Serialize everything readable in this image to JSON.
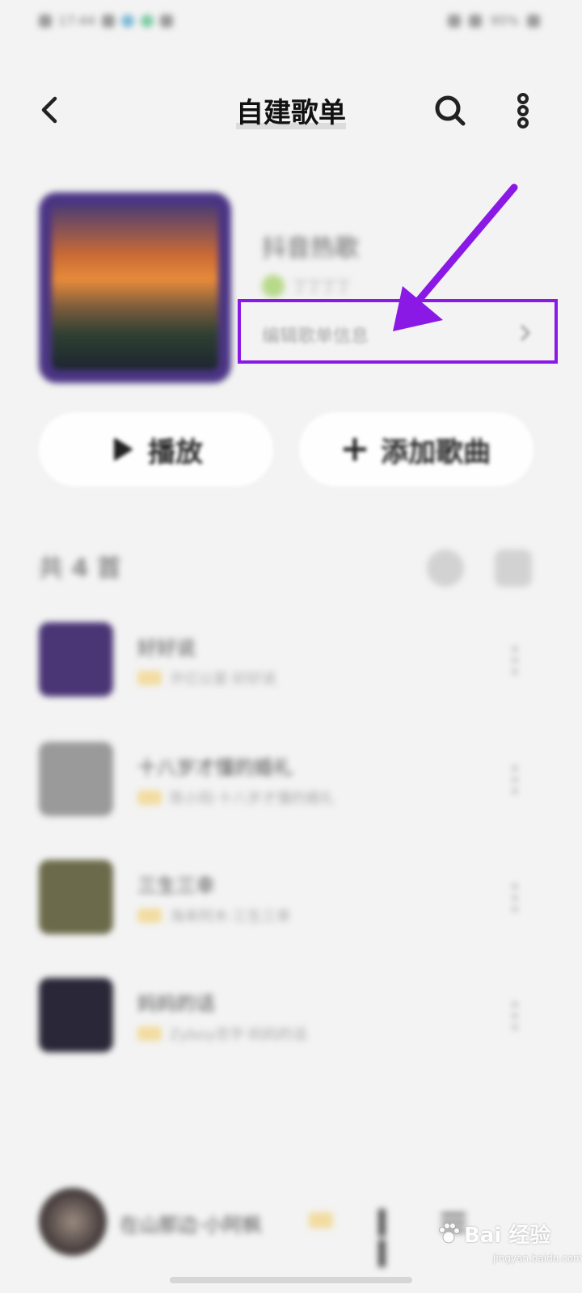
{
  "status_bar": {
    "time": "17:44",
    "battery": "95%"
  },
  "nav": {
    "title": "自建歌单"
  },
  "playlist": {
    "title": "抖音热歌",
    "creator": "丁丁丁丁",
    "edit_info_label": "编辑歌单信息"
  },
  "actions": {
    "play_label": "播放",
    "add_label": "添加歌曲"
  },
  "songs_section": {
    "count_label": "共 4 首",
    "songs": [
      {
        "name": "好好说",
        "artist": "许亿以星·好好说",
        "thumb_color": "#4a3575"
      },
      {
        "name": "十八岁才懂的婚礼",
        "artist": "陈小阳·十八岁才懂的婚礼",
        "thumb_color": "#9a9a9a"
      },
      {
        "name": "三生三幸",
        "artist": "海来阿木·三生三幸",
        "thumb_color": "#6b6a4a"
      },
      {
        "name": "妈妈的话",
        "artist": "Zyboy忠宇·妈妈的话",
        "thumb_color": "#2a2838"
      }
    ]
  },
  "mini_player": {
    "now_playing": "在山那边·小阿枫"
  },
  "watermark": {
    "brand": "Bai 经验",
    "sub": "jingyan.baidu.com"
  },
  "colors": {
    "annotation": "#8b19e6",
    "background": "#f3f3f3"
  }
}
